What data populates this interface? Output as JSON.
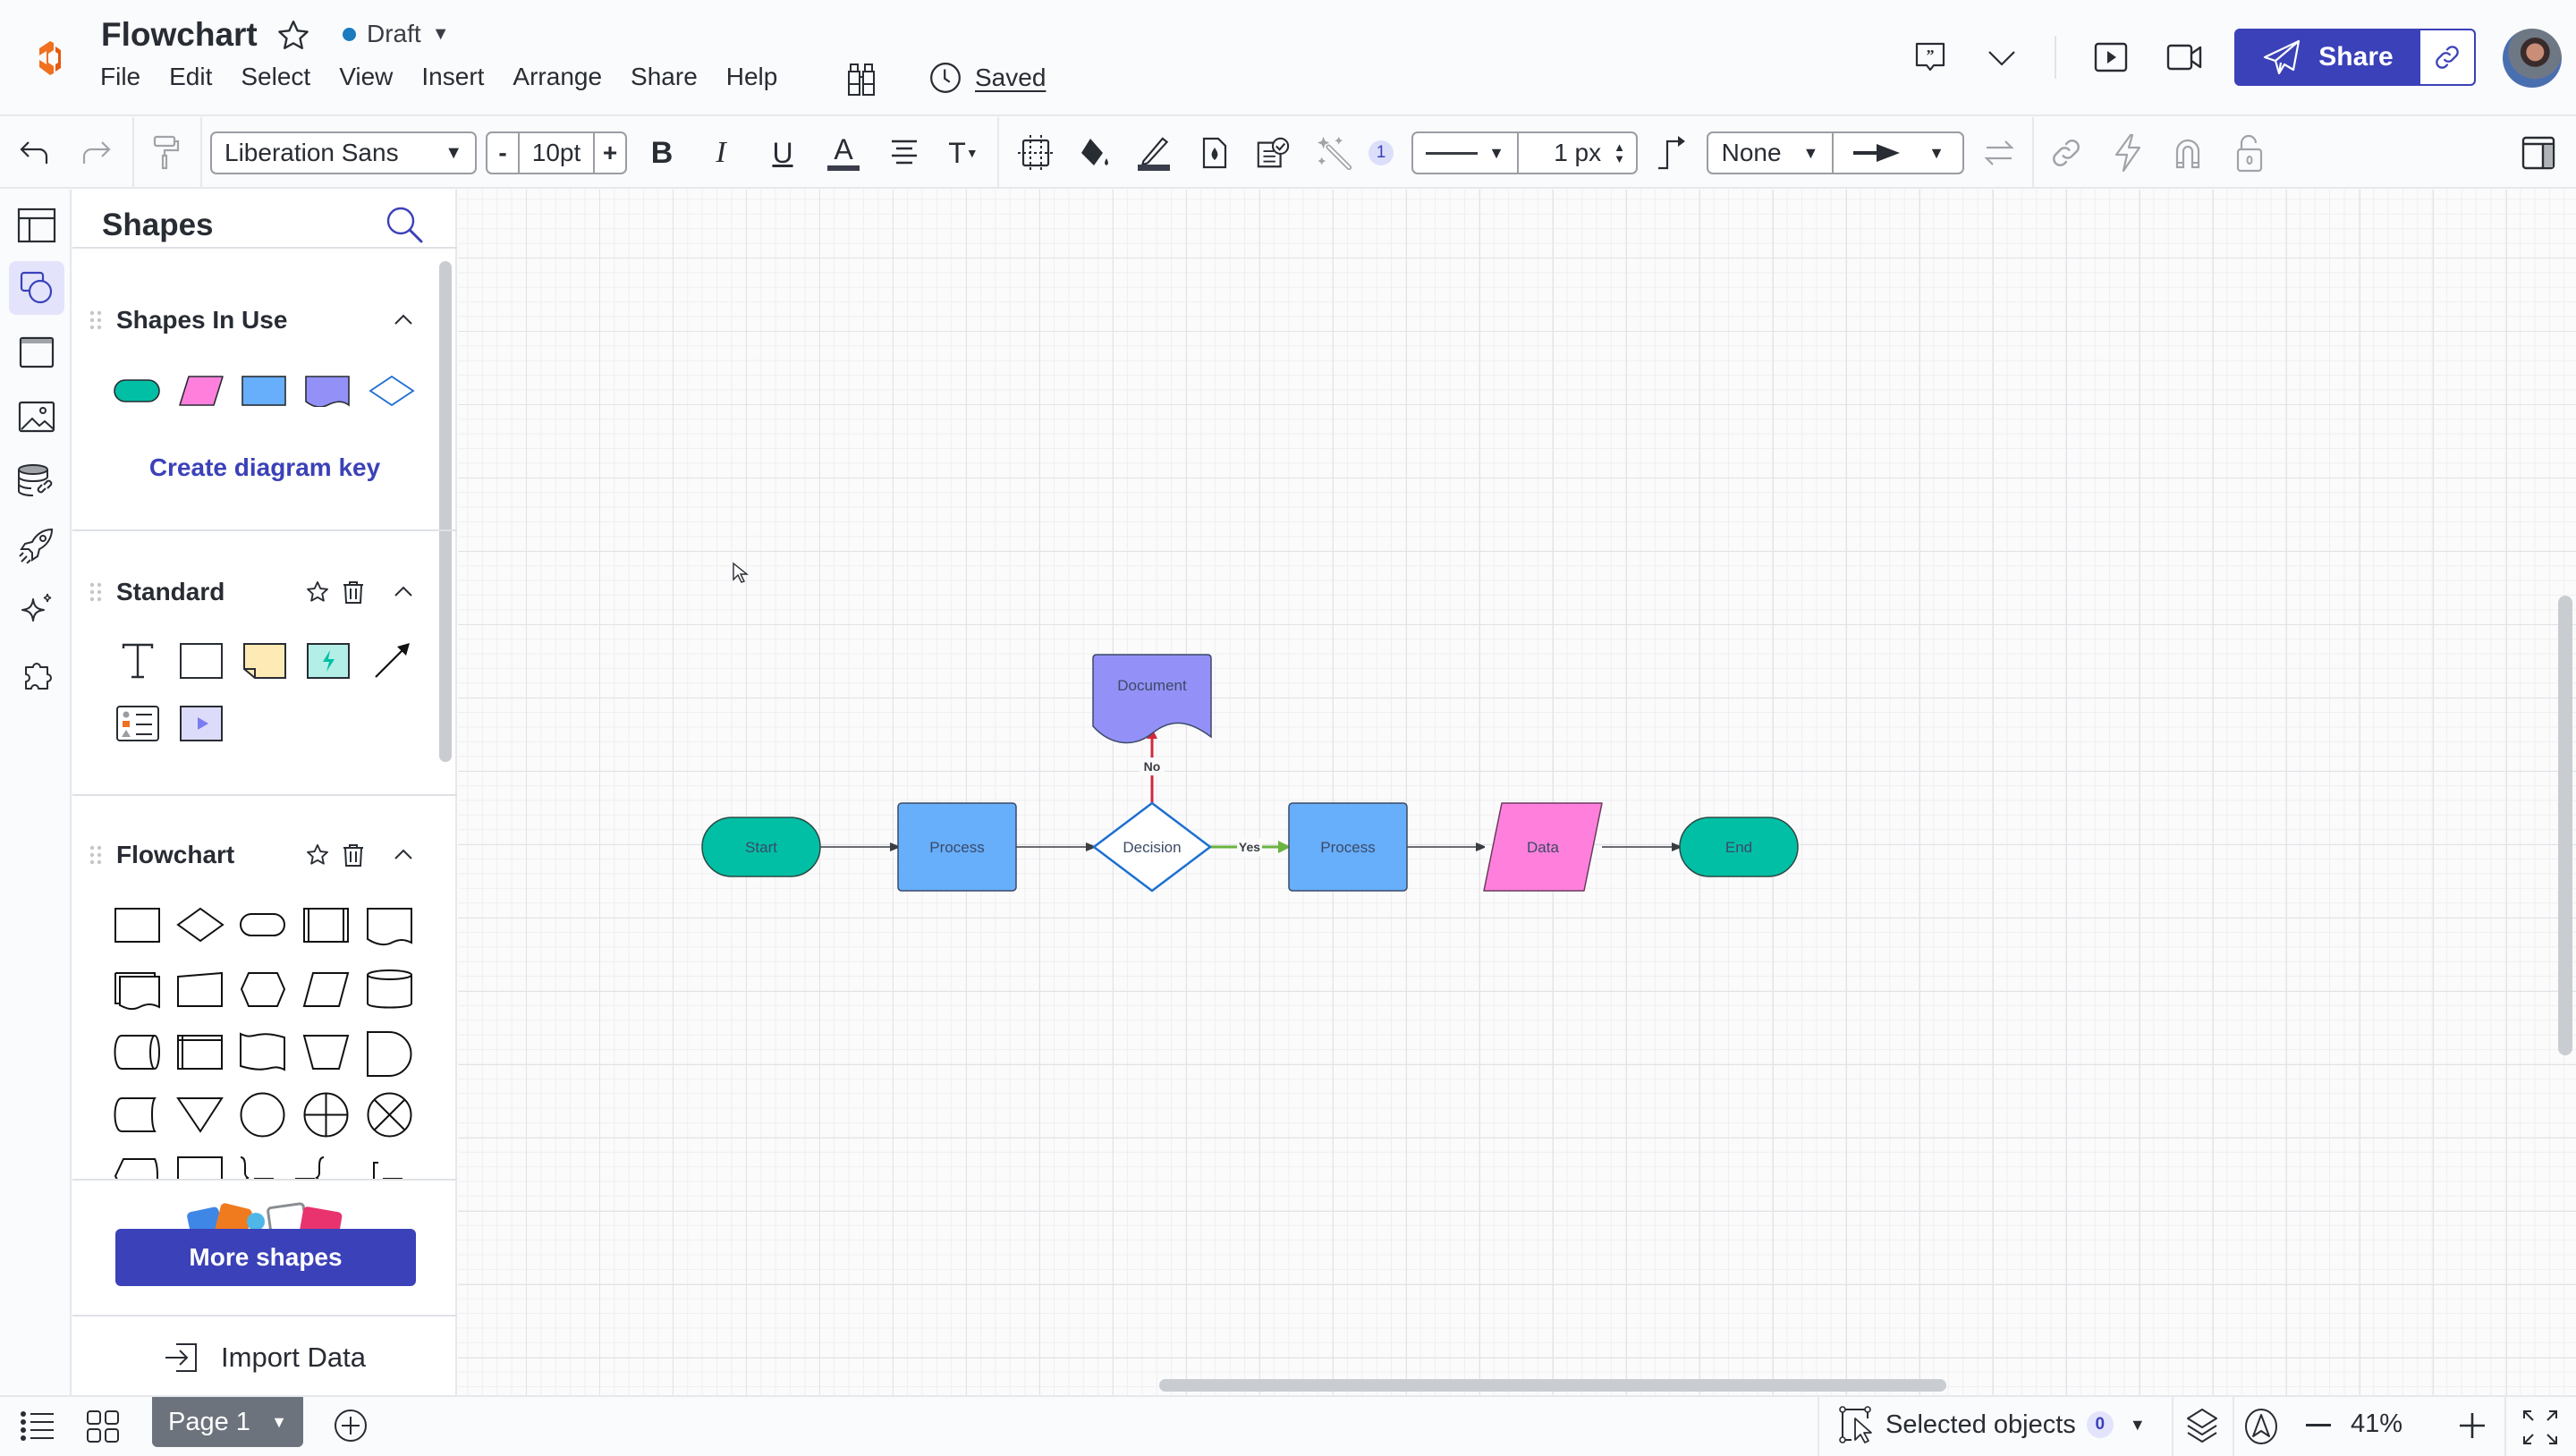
{
  "header": {
    "title": "Flowchart",
    "status": "Draft",
    "status_color": "#1a7bbf",
    "menu": [
      "File",
      "Edit",
      "Select",
      "View",
      "Insert",
      "Arrange",
      "Share",
      "Help"
    ],
    "saved_label": "Saved",
    "share_label": "Share",
    "brand_color": "#3b41b8",
    "icons": [
      "logo-icon",
      "star-icon",
      "binoculars-icon",
      "clock-icon",
      "comment-icon",
      "chevron-down-icon",
      "present-icon",
      "video-icon",
      "paper-plane-icon",
      "link-icon",
      "avatar"
    ]
  },
  "toolbar": {
    "font_family": "Liberation Sans",
    "font_size": "10pt",
    "font_size_minus": "-",
    "font_size_plus": "+",
    "bold": "B",
    "italic": "I",
    "underline": "U",
    "text_color": "A",
    "text_options": "T",
    "ai_badge": "1",
    "line_width": "1 px",
    "line_start": "None"
  },
  "panel": {
    "title": "Shapes",
    "sections": [
      {
        "title": "Shapes In Use",
        "link": "Create diagram key"
      },
      {
        "title": "Standard"
      },
      {
        "title": "Flowchart"
      }
    ],
    "shapes_in_use": [
      "terminator-teal",
      "data-pink",
      "process-blue",
      "document-purple",
      "decision-outline"
    ],
    "more_shapes_label": "More shapes",
    "import_label": "Import Data"
  },
  "diagram": {
    "nodes": [
      {
        "id": "start",
        "type": "terminator",
        "label": "Start",
        "fill": "#00bfa5"
      },
      {
        "id": "process1",
        "type": "process",
        "label": "Process",
        "fill": "#67aefb"
      },
      {
        "id": "decision",
        "type": "decision",
        "label": "Decision",
        "fill": "#ffffff"
      },
      {
        "id": "document",
        "type": "document",
        "label": "Document",
        "fill": "#9391f7"
      },
      {
        "id": "process2",
        "type": "process",
        "label": "Process",
        "fill": "#67aefb"
      },
      {
        "id": "data",
        "type": "data",
        "label": "Data",
        "fill": "#ff80dc"
      },
      {
        "id": "end",
        "type": "terminator",
        "label": "End",
        "fill": "#00bfa5"
      }
    ],
    "edges": [
      {
        "from": "start",
        "to": "process1",
        "label": "",
        "color": "#3a3d43"
      },
      {
        "from": "process1",
        "to": "decision",
        "label": "",
        "color": "#3a3d43"
      },
      {
        "from": "decision",
        "to": "document",
        "label": "No",
        "color": "#d0293e"
      },
      {
        "from": "decision",
        "to": "process2",
        "label": "Yes",
        "color": "#6ab43f"
      },
      {
        "from": "process2",
        "to": "data",
        "label": "",
        "color": "#3a3d43"
      },
      {
        "from": "data",
        "to": "end",
        "label": "",
        "color": "#3a3d43"
      }
    ]
  },
  "footer": {
    "page_label": "Page 1",
    "selected_label": "Selected objects",
    "selected_count": "0",
    "zoom": "41%"
  }
}
